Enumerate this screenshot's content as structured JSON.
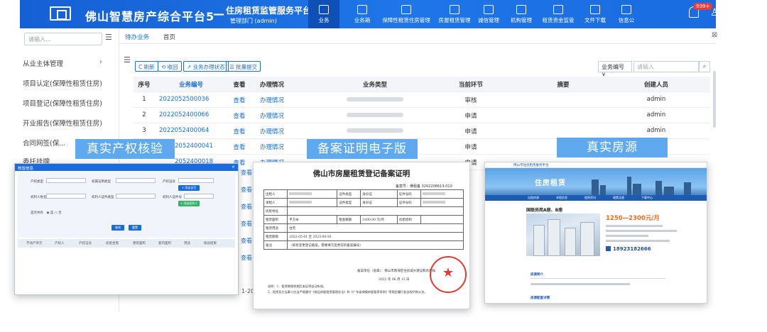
{
  "header": {
    "app_title": "佛山智慧房产综合平台5",
    "dash": "—",
    "sub_title": "住房租赁监管服务平台",
    "dept": "管理部门 (admin)",
    "nav_left": "‹",
    "nav_right": "›",
    "nav_items": [
      {
        "label": "业务",
        "icon": "briefcase-icon"
      },
      {
        "label": "业务箱",
        "icon": "inbox-icon"
      },
      {
        "label": "保障性租赁住房管理",
        "icon": "building-icon"
      },
      {
        "label": "房屋租赁管理",
        "icon": "house-icon"
      },
      {
        "label": "诚信管理",
        "icon": "document-icon"
      },
      {
        "label": "机构管理",
        "icon": "document-icon"
      },
      {
        "label": "租赁资金监管",
        "icon": "money-bag-icon"
      },
      {
        "label": "文件下载",
        "icon": "file-icon"
      },
      {
        "label": "信息公",
        "icon": "speaker-icon"
      }
    ],
    "badge": "999+",
    "user_icon": "♙"
  },
  "sidebar": {
    "search_placeholder": "请输入...",
    "toggle": "☰",
    "items": [
      {
        "label": "从业主体管理",
        "arrow": "›"
      },
      {
        "label": "项目认定(保障性租赁住房)"
      },
      {
        "label": "项目登记(保障性租赁住房)"
      },
      {
        "label": "开业报告(保障性租赁住房)"
      },
      {
        "label": "合同网签(保..."
      },
      {
        "label": "委托挂牌"
      }
    ]
  },
  "tabs": [
    "待办业务",
    "首页"
  ],
  "close_glyph": "⊠",
  "menu_glyph": "☰",
  "toolbar": {
    "buttons": [
      "C 刷新",
      "⟲ 收回",
      "↗ 业务办理状态",
      "☰ 批量提交"
    ],
    "select_value": "业务编号  ∨",
    "search_placeholder": "请输入",
    "search_icon": "⌕"
  },
  "table": {
    "headers": [
      "序号",
      "业务编号",
      "查看",
      "办理情况",
      "业务类型",
      "当前环节",
      "摘要",
      "创建人员"
    ],
    "rows": [
      {
        "no": "1",
        "code": "2022052500036",
        "view": "查看",
        "proc": "办理情况",
        "step": "审核",
        "creator": "admin"
      },
      {
        "no": "2",
        "code": "2022052400066",
        "view": "查看",
        "proc": "办理情况",
        "step": "申请",
        "creator": "admin"
      },
      {
        "no": "3",
        "code": "2022052400064",
        "view": "查看",
        "proc": "办理情况",
        "step": "申请",
        "creator": "admin"
      },
      {
        "no": "",
        "code": "2052400041",
        "view": "查看",
        "proc": "办理情况",
        "step": "申请",
        "creator": ""
      },
      {
        "no": "",
        "code": "2052400018",
        "view": "查看",
        "proc": "办理情况",
        "step": "申请",
        "creator": ""
      }
    ],
    "more_view": "查看",
    "footer_fragment": "1-20"
  },
  "captions": {
    "c1": "真实产权核验",
    "c2": "备案证明电子版",
    "c3": "真实房源"
  },
  "card1": {
    "header": "核验信息",
    "close": "×",
    "buttons": {
      "query": "查询",
      "reset": "重置",
      "add1": "+ 添加证号",
      "add2": "+ 添加权利人"
    },
    "col_headers": [
      "不动产单元",
      "产权人",
      "产权证号",
      "房屋坐落",
      "建筑面积",
      "套内面积",
      "用途",
      "核验结果"
    ]
  },
  "card2": {
    "title": "佛山市房屋租赁登记备案证明",
    "cert_no": "备案号：佛租备 3202208613-010",
    "rows": [
      [
        "出租人",
        "",
        "证件类型",
        "身份证",
        "证件号码",
        ""
      ],
      [
        "承租人",
        "",
        "证件类型",
        "身份证",
        "证件号码",
        ""
      ],
      [
        "房屋地址",
        "",
        "",
        "",
        "",
        ""
      ],
      [
        "租赁面积",
        "平方米",
        "租金数额",
        "1000.00 元/月",
        "房屋结构",
        ""
      ],
      [
        "租赁用途",
        "住宅",
        "",
        "",
        "",
        ""
      ],
      [
        "租赁期限",
        "2022-05-01 至 2023-04-30",
        "",
        "",
        "",
        ""
      ],
      [
        "备注",
        "（如有变更登记备案，需要填写变更前的备案编号）",
        "",
        "",
        "",
        ""
      ]
    ],
    "issuer": "备案单位（盖章）：佛山市南海区住房城乡建设和水利局",
    "date": "2022 年 06 月 15 日",
    "note1": "说明：1、租赁期限到期后本证明自动失效。",
    "note2": "2、租赁双方当事人应当严格遵守《商品房屋租赁管理办法》和《广东省城镇房屋租赁条例》等规定履行各自权利和义务。"
  },
  "card3": {
    "site_name": "佛山市住房租赁服务平台",
    "banner_title": "住房租赁",
    "nav": [
      "出租房源",
      "求租信息",
      "租赁资讯",
      "政策法规",
      "下载中心"
    ],
    "listing_title": "国联尚苑A座、B座",
    "price": "1250—2300元/月",
    "phone": "18923182666",
    "intro": "房源简介",
    "detail": "房源配套详情"
  }
}
